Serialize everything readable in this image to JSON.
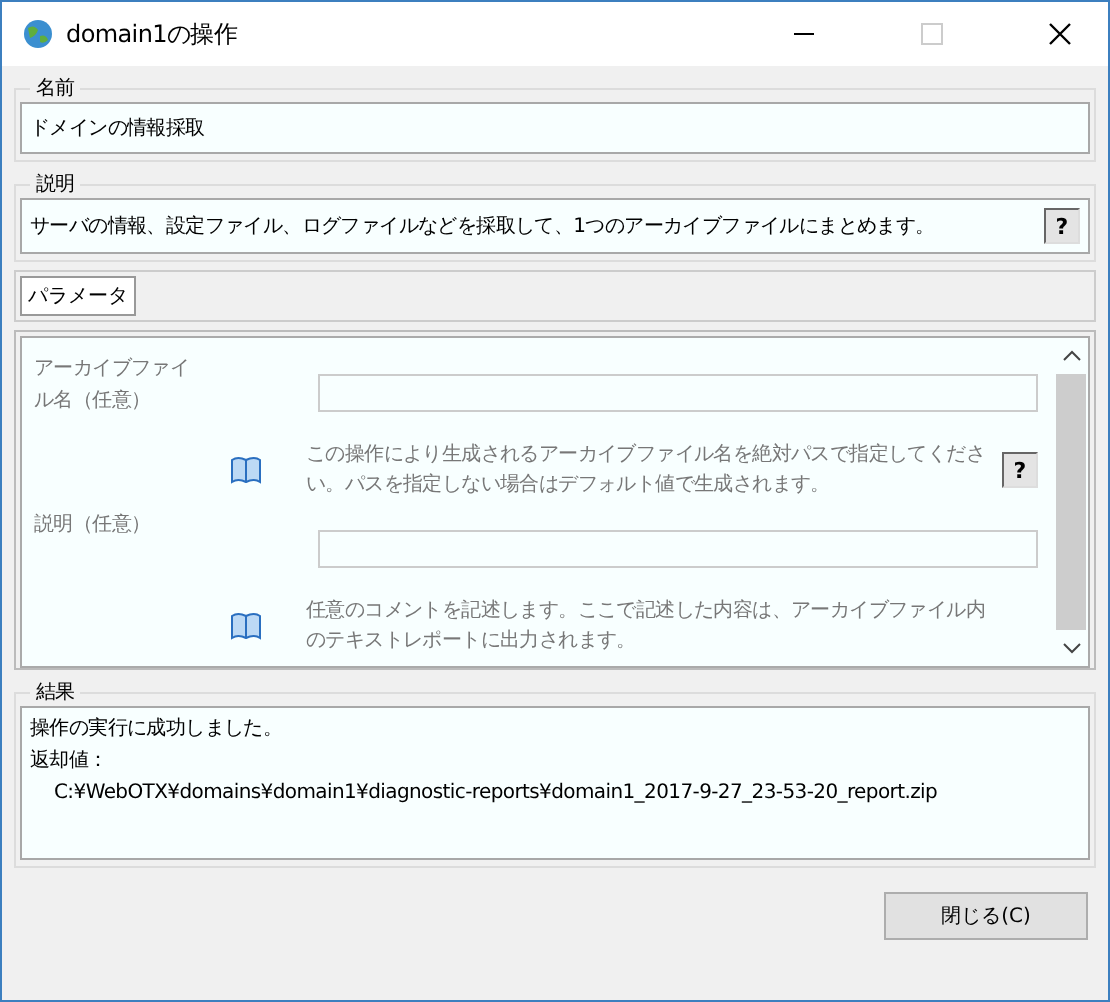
{
  "window": {
    "title": "domain1の操作"
  },
  "name_group": {
    "label": "名前",
    "value": "ドメインの情報採取"
  },
  "description_group": {
    "label": "説明",
    "text": "サーバの情報、設定ファイル、ログファイルなどを採取して、1つのアーカイブファイルにまとめます。",
    "help": "?"
  },
  "tabs": [
    {
      "label": "パラメータ",
      "selected": true
    }
  ],
  "parameters": [
    {
      "label": "アーカイブファイル名（任意）",
      "hint": "この操作により生成されるアーカイブファイル名を絶対パスで指定してください。パスを指定しない場合はデフォルト値で生成されます。",
      "help": "?"
    },
    {
      "label": "説明（任意）",
      "hint": "任意のコメントを記述します。ここで記述した内容は、アーカイブファイル内のテキストレポートに出力されます。"
    }
  ],
  "result_group": {
    "label": "結果",
    "lines": [
      "操作の実行に成功しました。",
      "返却値：",
      "C:¥WebOTX¥domains¥domain1¥diagnostic-reports¥domain1_2017-9-27_23-53-20_report.zip"
    ]
  },
  "buttons": [
    "閉じる(C)"
  ]
}
